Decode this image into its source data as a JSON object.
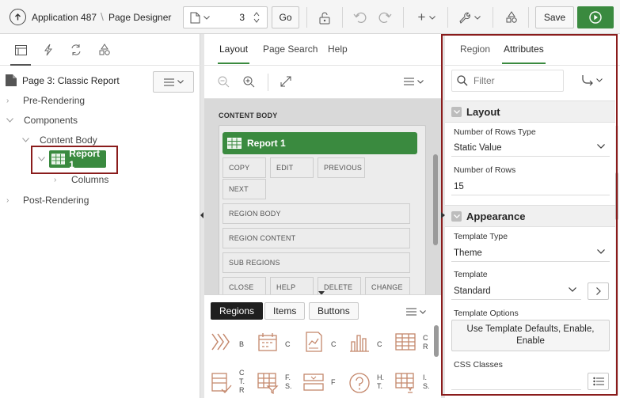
{
  "toolbar": {
    "app_link": "Application 487",
    "title": "Page Designer",
    "page_number": "3",
    "go_label": "Go",
    "save_label": "Save"
  },
  "left": {
    "page_label": "Page 3: Classic Report",
    "tree": {
      "pre_rendering": "Pre-Rendering",
      "components": "Components",
      "content_body": "Content Body",
      "report": "Report 1",
      "columns": "Columns",
      "post_rendering": "Post-Rendering"
    }
  },
  "center": {
    "tabs": [
      "Layout",
      "Page Search",
      "Help"
    ],
    "content_body_label": "CONTENT BODY",
    "region_title": "Report 1",
    "slots": {
      "copy": "COPY",
      "edit": "EDIT",
      "previous": "PREVIOUS",
      "next": "NEXT",
      "region_body": "REGION BODY",
      "region_content": "REGION CONTENT",
      "sub_regions": "SUB REGIONS",
      "close": "CLOSE",
      "help": "HELP",
      "delete": "DELETE",
      "change": "CHANGE"
    },
    "gallery": {
      "tabs": [
        "Regions",
        "Items",
        "Buttons"
      ],
      "labels": [
        "B",
        "C",
        "C",
        "C",
        "C\nR",
        "C\nT.\nR",
        "F.\nS.",
        "F",
        "H.\nT.",
        "I.\nS."
      ]
    }
  },
  "right": {
    "tabs": [
      "Region",
      "Attributes"
    ],
    "filter_placeholder": "Filter",
    "layout_group": "Layout",
    "appearance_group": "Appearance",
    "props": {
      "rows_type_label": "Number of Rows Type",
      "rows_type_value": "Static Value",
      "rows_label": "Number of Rows",
      "rows_value": "15",
      "template_type_label": "Template Type",
      "template_type_value": "Theme",
      "template_label": "Template",
      "template_value": "Standard",
      "template_options_label": "Template Options",
      "template_options_value": "Use Template Defaults, Enable, Enable",
      "css_classes_label": "CSS Classes"
    }
  }
}
